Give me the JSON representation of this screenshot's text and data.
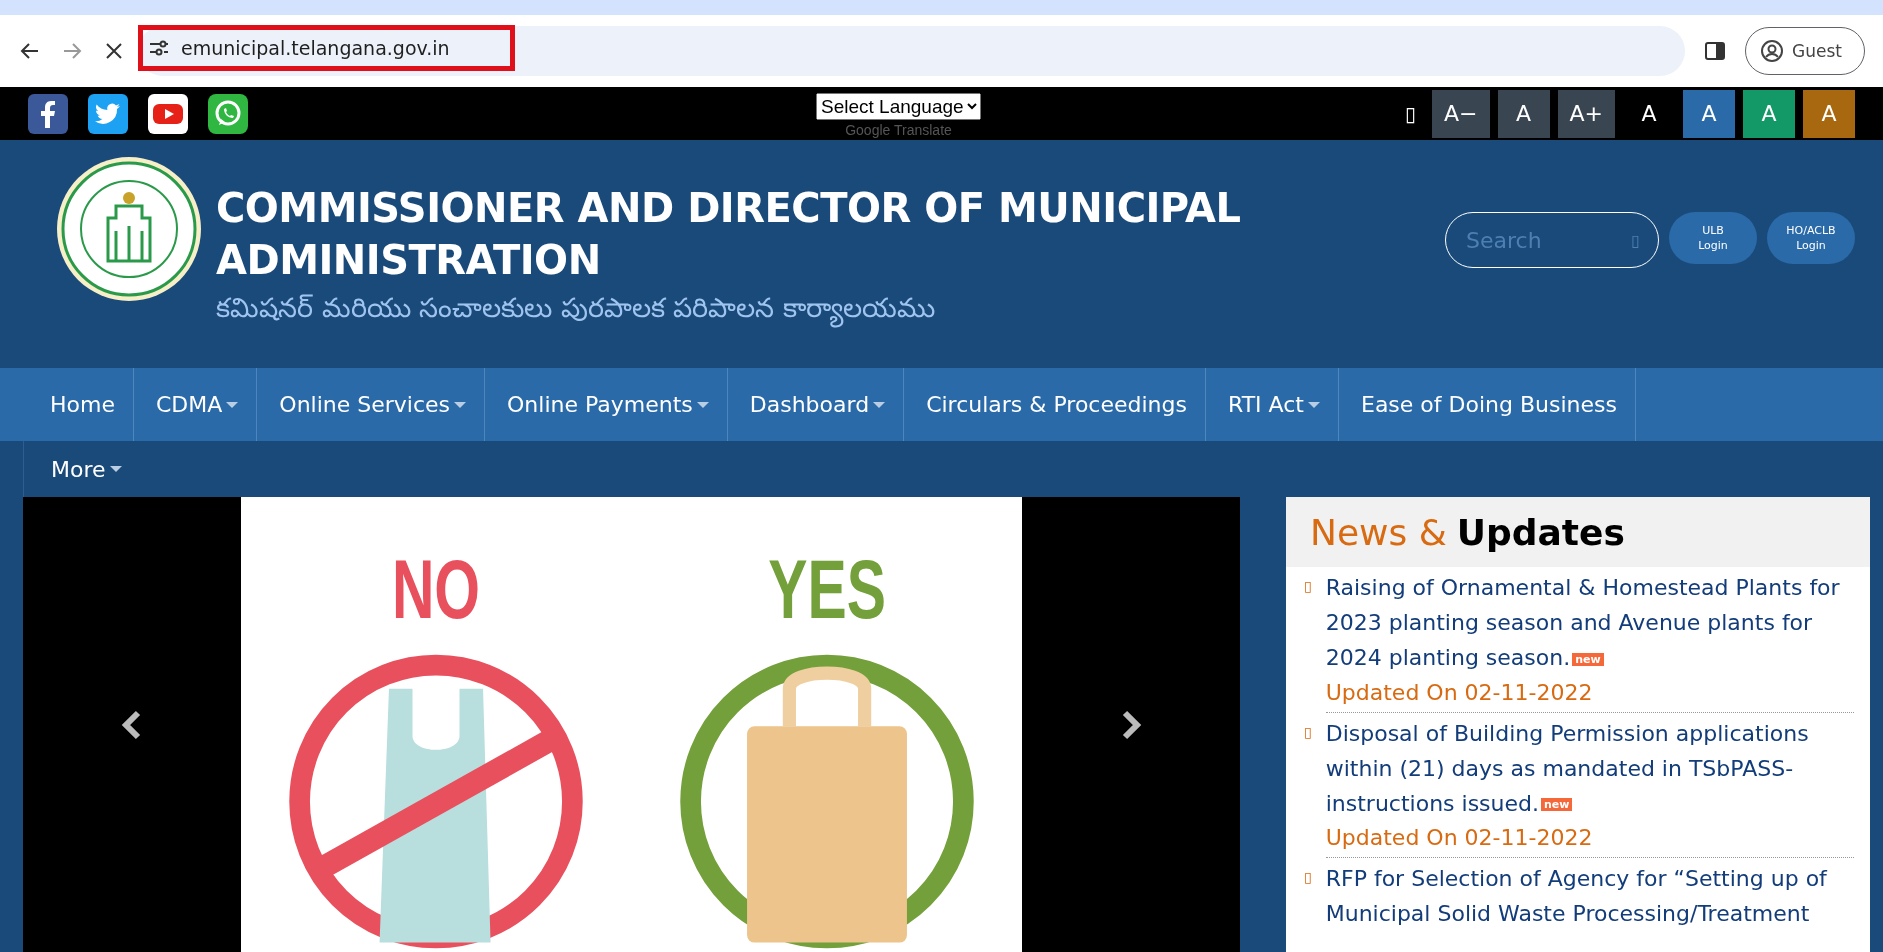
{
  "browser": {
    "url": "emunicipal.telangana.gov.in",
    "profile": "Guest"
  },
  "topbar": {
    "language_select": "Select Language",
    "translate_credit": "Google Translate",
    "missing_glyph": "▯",
    "font_controls": [
      {
        "label": "A−",
        "color": "#3a4552"
      },
      {
        "label": "A",
        "color": "#3a4552"
      },
      {
        "label": "A+",
        "color": "#3a4552"
      },
      {
        "label": "A",
        "color": "#000000"
      },
      {
        "label": "A",
        "color": "#2a6aa8"
      },
      {
        "label": "A",
        "color": "#139868"
      },
      {
        "label": "A",
        "color": "#a8680f"
      }
    ]
  },
  "header": {
    "title": "COMMISSIONER AND DIRECTOR OF MUNICIPAL ADMINISTRATION",
    "subtitle": "కమిషనర్ మరియు సంచాలకులు పురపాలక పరిపాలన కార్యాలయము",
    "search": {
      "placeholder": "Search",
      "icon": "▯"
    },
    "buttons": [
      {
        "line1": "ULB",
        "line2": "Login"
      },
      {
        "line1": "HO/ACLB",
        "line2": "Login"
      }
    ]
  },
  "nav": [
    {
      "label": "Home",
      "dropdown": false
    },
    {
      "label": "CDMA",
      "dropdown": true
    },
    {
      "label": "Online Services",
      "dropdown": true
    },
    {
      "label": "Online Payments",
      "dropdown": true
    },
    {
      "label": "Dashboard",
      "dropdown": true
    },
    {
      "label": "Circulars & Proceedings",
      "dropdown": false
    },
    {
      "label": "RTI Act",
      "dropdown": true
    },
    {
      "label": "Ease of Doing Business",
      "dropdown": false
    },
    {
      "label": "More",
      "dropdown": true
    }
  ],
  "slide": {
    "left_label": "NO",
    "right_label": "YES"
  },
  "news": {
    "title_light": "News &",
    "title_bold": "Updates",
    "bullet": "▯",
    "items": [
      {
        "text": "Raising of Ornamental & Homestead Plants for 2023 planting season and Avenue plants for 2024 planting season.",
        "badge": "new",
        "date": "Updated On 02-11-2022"
      },
      {
        "text": "Disposal of Building Permission applications within (21) days as mandated in TSbPASS-instructions issued.",
        "badge": "new",
        "date": "Updated On 02-11-2022"
      },
      {
        "text": "RFP for Selection of Agency for “Setting up of Municipal Solid Waste Processing/Treatment"
      }
    ]
  }
}
